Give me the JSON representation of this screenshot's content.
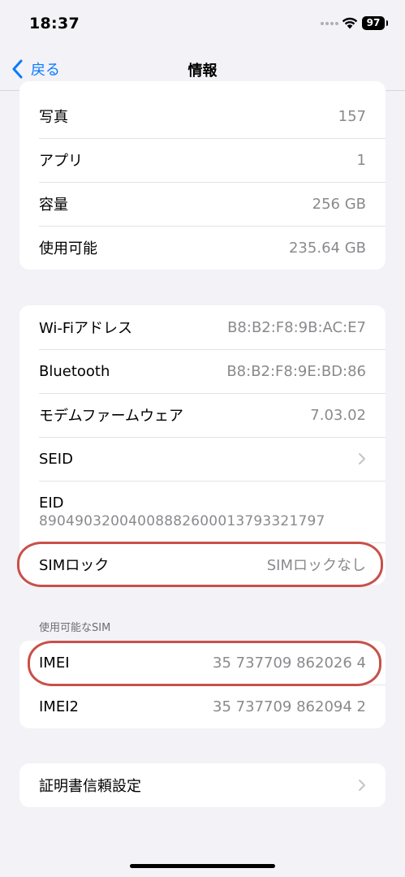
{
  "status_bar": {
    "time": "18:37",
    "battery": "97"
  },
  "nav": {
    "back_label": "戻る",
    "title": "情報"
  },
  "group1": [
    {
      "label": "写真",
      "value": "157"
    },
    {
      "label": "アプリ",
      "value": "1"
    },
    {
      "label": "容量",
      "value": "256 GB"
    },
    {
      "label": "使用可能",
      "value": "235.64 GB"
    }
  ],
  "group2": {
    "wifi": {
      "label": "Wi-Fiアドレス",
      "value": "B8:B2:F8:9B:AC:E7"
    },
    "bluetooth": {
      "label": "Bluetooth",
      "value": "B8:B2:F8:9E:BD:86"
    },
    "modem": {
      "label": "モデムファームウェア",
      "value": "7.03.02"
    },
    "seid": {
      "label": "SEID"
    },
    "eid": {
      "label": "EID",
      "value": "89049032004008882600013793321797"
    },
    "sim_lock": {
      "label": "SIMロック",
      "value": "SIMロックなし"
    }
  },
  "sim_section": {
    "header": "使用可能なSIM",
    "imei": {
      "label": "IMEI",
      "value": "35 737709 862026 4"
    },
    "imei2": {
      "label": "IMEI2",
      "value": "35 737709 862094 2"
    }
  },
  "cert": {
    "label": "証明書信頼設定"
  },
  "colors": {
    "accent": "#0a7aff",
    "highlight": "#c8504a",
    "background": "#f2f2f7"
  }
}
